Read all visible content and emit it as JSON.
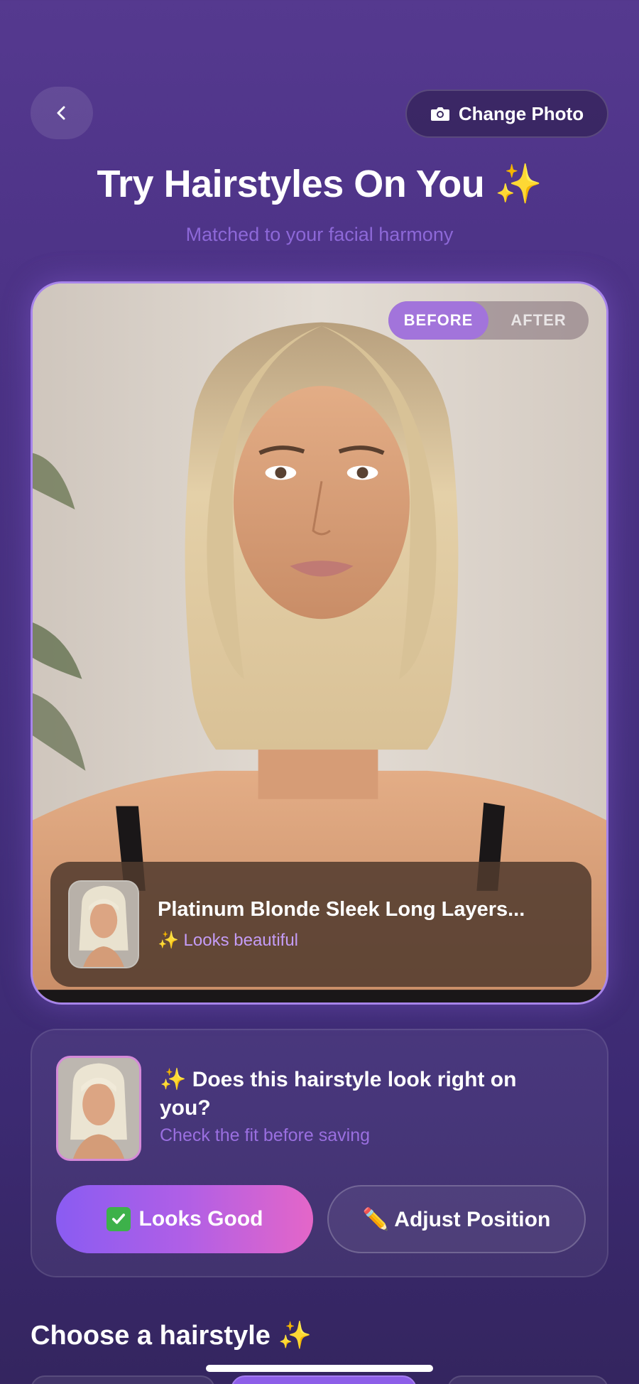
{
  "header": {
    "change_photo_label": "Change Photo",
    "title": "Try Hairstyles On You ✨",
    "subtitle": "Matched to your facial harmony"
  },
  "preview": {
    "toggle": {
      "before_label": "BEFORE",
      "after_label": "AFTER",
      "selected": "BEFORE"
    },
    "style_name": "Platinum Blonde Sleek Long Layers...",
    "style_status": "✨ Looks beautiful"
  },
  "confirm": {
    "question": "✨ Does this hairstyle look right on you?",
    "hint": "Check the fit before saving",
    "looks_good_label": "Looks Good",
    "adjust_label": "✏️ Adjust Position"
  },
  "section": {
    "title": "Choose a hairstyle ✨"
  },
  "colors": {
    "accent_purple": "#a274db",
    "gradient_start": "#8a5cf2",
    "gradient_end": "#e466c8",
    "hint_purple": "#9a6fe0"
  }
}
